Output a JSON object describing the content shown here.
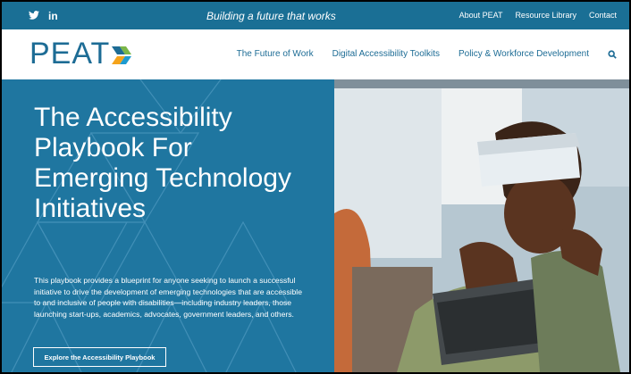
{
  "topbar": {
    "social": [
      {
        "name": "twitter-icon",
        "label": "🐦"
      },
      {
        "name": "linkedin-icon",
        "label": "in"
      }
    ],
    "tagline": "Building a future that works",
    "links": [
      "About PEAT",
      "Resource Library",
      "Contact"
    ]
  },
  "header": {
    "logo_text": "PEAT",
    "nav": [
      "The Future of Work",
      "Digital Accessibility Toolkits",
      "Policy & Workforce Development"
    ]
  },
  "hero": {
    "title": "The Accessibility Playbook For Emerging Technology Initiatives",
    "description": "This playbook provides a blueprint for anyone seeking to launch a successful initiative to drive the development of emerging technologies that are accessible to and inclusive of people with disabilities—including industry leaders, those launching start-ups, academics, advocates, government leaders, and others.",
    "cta": "Explore the Accessibility Playbook"
  },
  "colors": {
    "topbar": "#1a6f95",
    "hero": "#1f76a0",
    "brand": "#1d6c95"
  }
}
